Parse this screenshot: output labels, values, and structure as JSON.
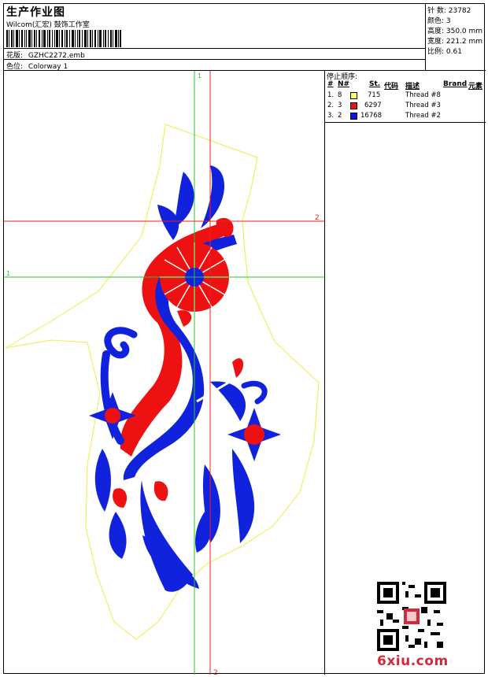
{
  "header": {
    "title": "生产作业图",
    "studio": "Wilcom(汇宏) 鼓饰工作室",
    "pattern_label": "花版:",
    "pattern_value": "GZHC2272.emb",
    "colorway_label": "色位:",
    "colorway_value": "Colorway 1"
  },
  "stats": {
    "stitches": "针 数: 23782",
    "colors": "颜色: 3",
    "height": "高度: 350.0 mm",
    "width": "宽度: 221.2 mm",
    "scale": "比例: 0.61"
  },
  "guides": {
    "vertical_1": "1",
    "vertical_2": "2",
    "horizontal_1": "1",
    "horizontal_2": "2"
  },
  "stop_sequence": {
    "title": "停止顺序:",
    "headers": {
      "num": "#",
      "needle": "N#",
      "stitches": "St.",
      "code": "代码",
      "desc": "描述",
      "brand": "Brand",
      "element": "元素"
    },
    "rows": [
      {
        "num": "1.",
        "needle": "8",
        "color": "#ffff66",
        "stitches": "715",
        "desc": "Thread #8"
      },
      {
        "num": "2.",
        "needle": "3",
        "color": "#ee1111",
        "stitches": "6297",
        "desc": "Thread #3"
      },
      {
        "num": "3.",
        "needle": "2",
        "color": "#1111ee",
        "stitches": "16768",
        "desc": "Thread #2"
      }
    ]
  },
  "colors": {
    "yellow_outline": "#eeee44",
    "red_thread": "#ee1111",
    "blue_thread": "#1122dd",
    "guide_green": "#22cc22",
    "guide_red": "#ee2222"
  },
  "watermark": {
    "text": "6xiu.com"
  }
}
